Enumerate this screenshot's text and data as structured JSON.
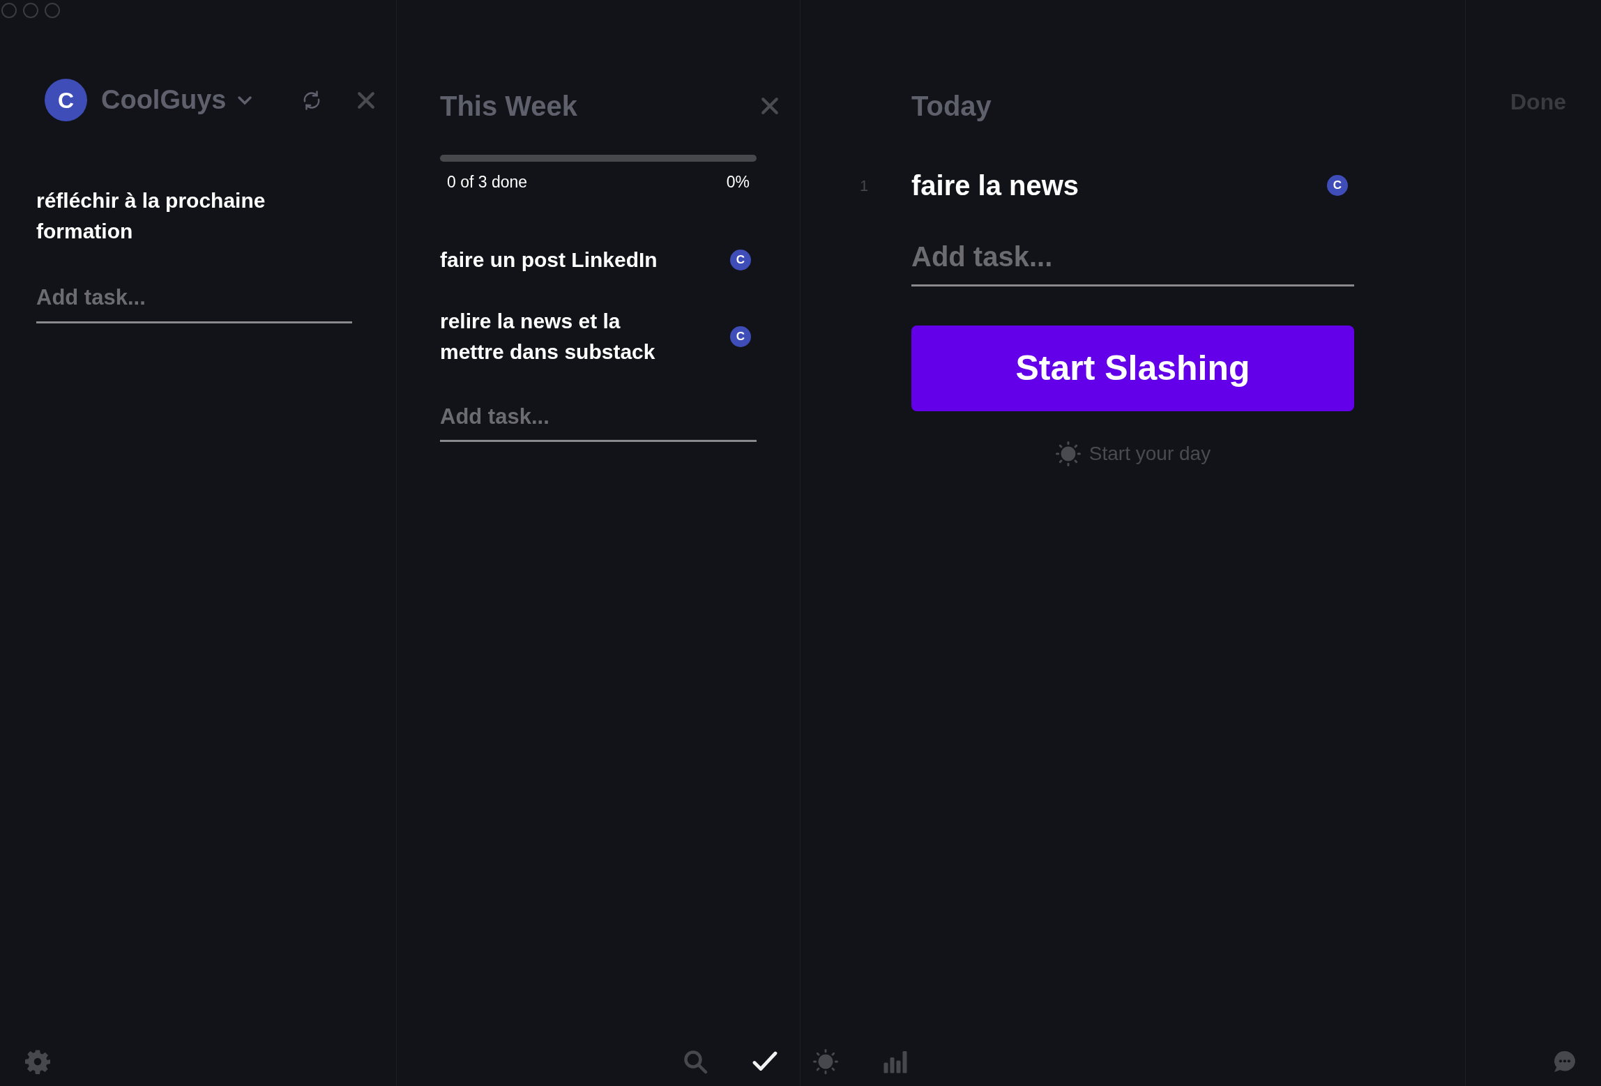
{
  "sidebar": {
    "avatar": "C",
    "workspace": "CoolGuys",
    "tasks": [
      {
        "text": "réfléchir à la prochaine formation"
      }
    ],
    "add_task": {
      "placeholder": "Add task..."
    },
    "toolbar": [
      {
        "kind": "gear",
        "selected": false
      }
    ]
  },
  "this_week": {
    "title": "This Week",
    "progress": {
      "level": 0,
      "done_text": "0 of 3 done",
      "percent": "0%"
    },
    "tasks": [
      {
        "text": "faire un post LinkedIn",
        "assignee": "C"
      },
      {
        "text": "relire la news et la mettre dans substack",
        "assignee": "C"
      }
    ],
    "add_task": {
      "placeholder": "Add task..."
    },
    "toolbar": [
      {
        "kind": "search",
        "selected": false
      },
      {
        "kind": "check",
        "selected": true
      }
    ]
  },
  "today": {
    "title": "Today",
    "tasks": [
      {
        "number": "1",
        "text": "faire la news",
        "assignee": "C"
      }
    ],
    "add_task": {
      "placeholder": "Add task..."
    },
    "start_button": "Start Slashing",
    "start_day_link": "Start your day",
    "toolbar": [
      {
        "kind": "sun",
        "selected": false
      },
      {
        "kind": "chart",
        "selected": false
      }
    ]
  },
  "done": {
    "title": "Done",
    "toolbar": [
      {
        "kind": "chat",
        "selected": false
      }
    ]
  }
}
